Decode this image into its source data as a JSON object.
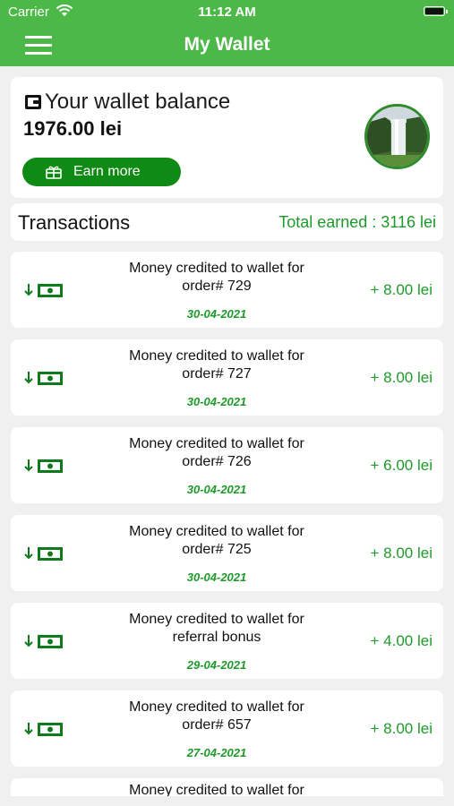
{
  "status_bar": {
    "carrier": "Carrier",
    "time": "11:12 AM"
  },
  "nav": {
    "title": "My Wallet",
    "menu_icon": "hamburger-menu-icon"
  },
  "balance": {
    "label": "Your wallet balance",
    "value": "1976.00 lei",
    "earn_button": "Earn more",
    "avatar": "waterfall-landscape-image"
  },
  "transactions": {
    "title": "Transactions",
    "total_earned": "Total earned : 3116 lei",
    "items": [
      {
        "line1": "Money credited to wallet for",
        "line2": "order# 729",
        "date": "30-04-2021",
        "amount": "+ 8.00 lei"
      },
      {
        "line1": "Money credited to wallet for",
        "line2": "order# 727",
        "date": "30-04-2021",
        "amount": "+ 8.00 lei"
      },
      {
        "line1": "Money credited to wallet for",
        "line2": "order# 726",
        "date": "30-04-2021",
        "amount": "+ 6.00 lei"
      },
      {
        "line1": "Money credited to wallet for",
        "line2": "order# 725",
        "date": "30-04-2021",
        "amount": "+ 8.00 lei"
      },
      {
        "line1": "Money credited to wallet for",
        "line2": "referral bonus",
        "date": "29-04-2021",
        "amount": "+ 4.00 lei"
      },
      {
        "line1": "Money credited to wallet for",
        "line2": "order# 657",
        "date": "27-04-2021",
        "amount": "+ 8.00 lei"
      }
    ],
    "partial_item": {
      "line1": "Money credited to wallet for"
    }
  },
  "colors": {
    "brand_green": "#4cb848",
    "button_green": "#0f8a14",
    "amount_green": "#1e9a2a"
  }
}
